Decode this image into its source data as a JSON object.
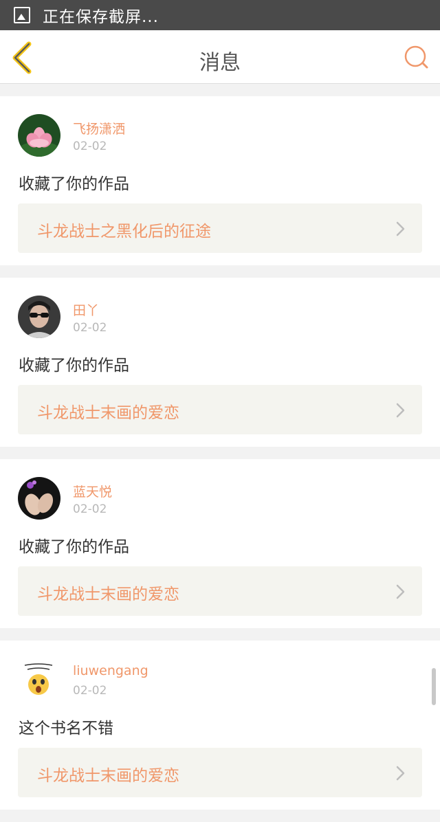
{
  "status_bar": {
    "text": "正在保存截屏...",
    "icon": "screenshot-icon"
  },
  "navbar": {
    "title": "消息",
    "back_icon": "chevron-left-icon",
    "search_icon": "search-icon",
    "accent": "#f0976a"
  },
  "messages": [
    {
      "username": "飞扬潇洒",
      "date": "02-02",
      "action": "收藏了你的作品",
      "work_title": "斗龙战士之黑化后的征途",
      "avatar": "lotus-avatar"
    },
    {
      "username": "田丫",
      "date": "02-02",
      "action": "收藏了你的作品",
      "work_title": "斗龙战士末画的爱恋",
      "avatar": "sunglasses-avatar"
    },
    {
      "username": "蓝天悦",
      "date": "02-02",
      "action": "收藏了你的作品",
      "work_title": "斗龙战士末画的爱恋",
      "avatar": "hands-avatar"
    },
    {
      "username": "liuwengang",
      "date": "02-02",
      "action": "这个书名不错",
      "work_title": "斗龙战士末画的爱恋",
      "avatar": "emoji-avatar"
    }
  ]
}
